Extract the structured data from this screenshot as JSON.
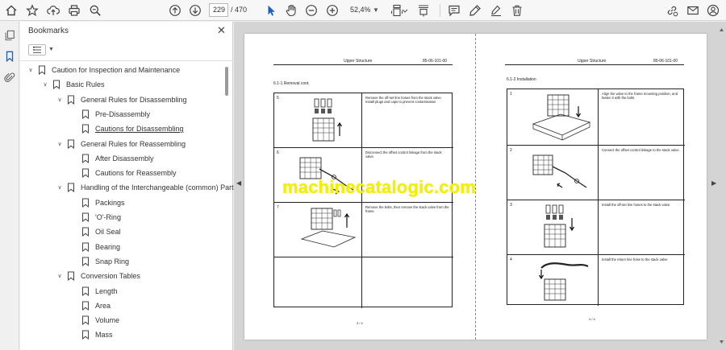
{
  "toolbar": {
    "page_current": "229",
    "page_total": "/ 470",
    "zoom": "52,4%",
    "icons": [
      "home-icon",
      "star-icon",
      "upload-icon",
      "print-icon",
      "search-zoom-icon",
      "page-up-icon",
      "page-down-icon",
      "select-cursor-icon",
      "hand-icon",
      "zoom-out-icon",
      "zoom-in-icon",
      "page-fit-icon",
      "scroll-mode-icon",
      "comment-icon",
      "highlight-pen-icon",
      "fill-sign-icon",
      "delete-icon",
      "share-link-icon",
      "mail-icon",
      "account-icon"
    ]
  },
  "left_rail": {
    "icons": [
      "pages-thumbnails-icon",
      "bookmarks-icon",
      "attachments-icon"
    ]
  },
  "bookmarks_panel": {
    "title": "Bookmarks",
    "items": [
      {
        "label": "Caution for Inspection and Maintenance",
        "level": 0,
        "expandable": true
      },
      {
        "label": "Basic Rules",
        "level": 1,
        "expandable": true
      },
      {
        "label": "General Rules for Disassembling",
        "level": 2,
        "expandable": true
      },
      {
        "label": "Pre-Disassembly",
        "level": 3,
        "expandable": false
      },
      {
        "label": "Cautions for Disassembling",
        "level": 3,
        "expandable": false,
        "selected": true
      },
      {
        "label": "General Rules for Reassembling",
        "level": 2,
        "expandable": true
      },
      {
        "label": "After Disassembly",
        "level": 3,
        "expandable": false
      },
      {
        "label": "Cautions for Reassembly",
        "level": 3,
        "expandable": false
      },
      {
        "label": "Handling of the Interchangeable (common) Parts",
        "level": 2,
        "expandable": true
      },
      {
        "label": "Packings",
        "level": 3,
        "expandable": false
      },
      {
        "label": "'O'-Ring",
        "level": 3,
        "expandable": false
      },
      {
        "label": "Oil Seal",
        "level": 3,
        "expandable": false
      },
      {
        "label": "Bearing",
        "level": 3,
        "expandable": false
      },
      {
        "label": "Snap Ring",
        "level": 3,
        "expandable": false
      },
      {
        "label": "Conversion Tables",
        "level": 2,
        "expandable": true
      },
      {
        "label": "Length",
        "level": 3,
        "expandable": false
      },
      {
        "label": "Area",
        "level": 3,
        "expandable": false
      },
      {
        "label": "Volume",
        "level": 3,
        "expandable": false
      },
      {
        "label": "Mass",
        "level": 3,
        "expandable": false
      }
    ]
  },
  "document": {
    "watermark": "machinecatalogic.com",
    "left_page": {
      "header_title": "Upper Structure",
      "header_code": "85-06-101-00",
      "section": "6.1-1   Removal cont.",
      "steps": [
        {
          "num": "5",
          "text": "Remove the off-set line hoses from the stack valve. Install plugs and caps to prevent contamination"
        },
        {
          "num": "6",
          "text": "Disconnect the offset control linkage from the stack valve."
        },
        {
          "num": "7",
          "text": "Remove the bolts, then remove the stack valve from the frame"
        },
        {
          "num": "",
          "text": ""
        }
      ],
      "page_number": "3 / 4"
    },
    "right_page": {
      "header_title": "Upper Structure",
      "header_code": "85-06-101-00",
      "section": "6.1-2   Installation",
      "steps": [
        {
          "num": "1",
          "text": "Align the valve to the frame mounting position, and fasten it with the bolts"
        },
        {
          "num": "2",
          "text": "Connect the offset control linkage to the stack valve."
        },
        {
          "num": "3",
          "text": "Install the off-set line hoses to the stack valve."
        },
        {
          "num": "4",
          "text": "Install the return line hose to the stack valve"
        }
      ],
      "page_number": "4 / 4"
    }
  }
}
